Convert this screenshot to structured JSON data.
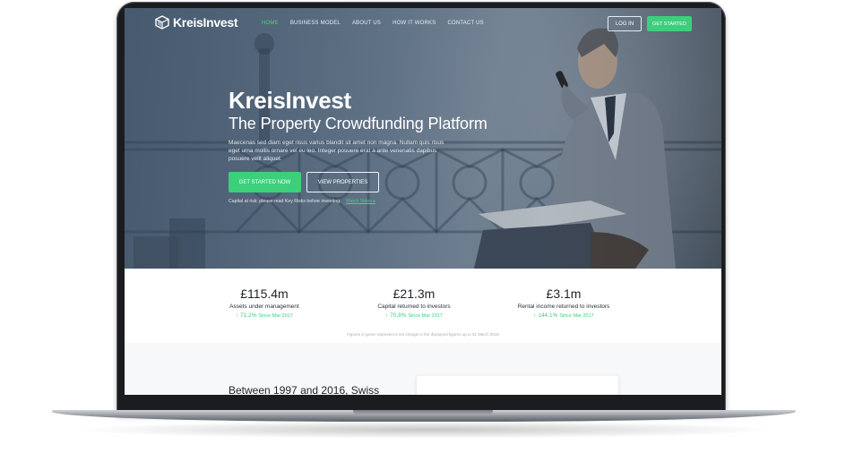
{
  "nav": {
    "logo_text": "KreisInvest",
    "items": [
      {
        "label": "HOME",
        "active": true
      },
      {
        "label": "BUSINESS MODEL",
        "active": false
      },
      {
        "label": "ABOUT US",
        "active": false
      },
      {
        "label": "HOW IT WORKS",
        "active": false
      },
      {
        "label": "CONTACT US",
        "active": false
      }
    ],
    "login_label": "LOG IN",
    "get_started_label": "GET STARTED"
  },
  "hero": {
    "title": "KreisInvest",
    "subtitle": "The Property Crowdfunding Platform",
    "body": "Maecenas sed diam eget risus varius blandit sit amet non magna. Nullam quis risus eget urna mollis ornare vel eu leo. Integer posuere erat a ante venenatis dapibus posuere velit aliquet.",
    "cta_primary": "GET STARTED NOW",
    "cta_secondary": "VIEW PROPERTIES",
    "risk_text": "Capital at risk: please read Key Risks before investing.",
    "watch_video": "Watch Video"
  },
  "stats": [
    {
      "value": "£115.4m",
      "label": "Assets under management",
      "change": "71.2%",
      "since": "Since Mar 2017"
    },
    {
      "value": "£21.3m",
      "label": "Capital returned to investors",
      "change": "70.8%",
      "since": "Since Mar 2017"
    },
    {
      "value": "£3.1m",
      "label": "Rental income returned to investors",
      "change": "144.1%",
      "since": "Since Mar 2017"
    }
  ],
  "footnote": "Figures in green represent a net change in the displayed figures up to 31 March 2018",
  "lower": {
    "heading": "Between 1997 and 2016, Swiss"
  },
  "colors": {
    "accent": "#3ccf7c",
    "hero_tint": "#5d7185",
    "bezel": "#1b1c1f"
  }
}
